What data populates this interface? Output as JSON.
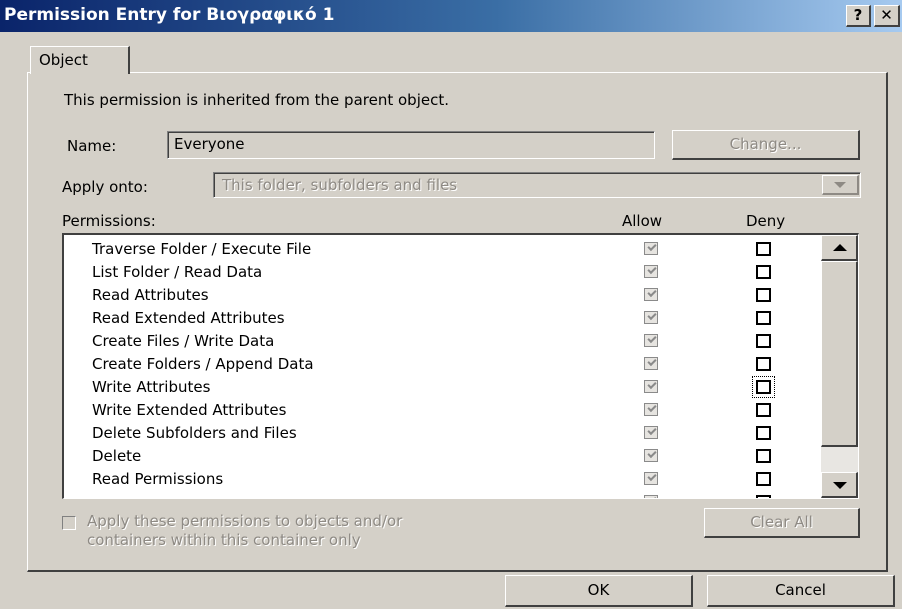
{
  "window": {
    "title": "Permission Entry for Βιογραφικό 1",
    "help_label": "?",
    "close_label": "✕"
  },
  "tab": {
    "label": "Object"
  },
  "inherited_text": "This permission is inherited from the parent object.",
  "name": {
    "label": "Name:",
    "value": "Everyone",
    "change_button": "Change..."
  },
  "apply_onto": {
    "label": "Apply onto:",
    "value": "This folder, subfolders and files"
  },
  "permissions": {
    "label": "Permissions:",
    "col_allow": "Allow",
    "col_deny": "Deny",
    "rows": [
      {
        "name": "Traverse Folder / Execute File",
        "allow": true,
        "deny": false
      },
      {
        "name": "List Folder / Read Data",
        "allow": true,
        "deny": false
      },
      {
        "name": "Read Attributes",
        "allow": true,
        "deny": false
      },
      {
        "name": "Read Extended Attributes",
        "allow": true,
        "deny": false
      },
      {
        "name": "Create Files / Write Data",
        "allow": true,
        "deny": false
      },
      {
        "name": "Create Folders / Append Data",
        "allow": true,
        "deny": false
      },
      {
        "name": "Write Attributes",
        "allow": true,
        "deny": false
      },
      {
        "name": "Write Extended Attributes",
        "allow": true,
        "deny": false
      },
      {
        "name": "Delete Subfolders and Files",
        "allow": true,
        "deny": false
      },
      {
        "name": "Delete",
        "allow": true,
        "deny": false
      },
      {
        "name": "Read Permissions",
        "allow": true,
        "deny": false
      }
    ]
  },
  "apply_checkbox": {
    "line1": "Apply these permissions to objects and/or",
    "line2": "containers within this container only"
  },
  "clear_all_label": "Clear All",
  "ok_label": "OK",
  "cancel_label": "Cancel"
}
